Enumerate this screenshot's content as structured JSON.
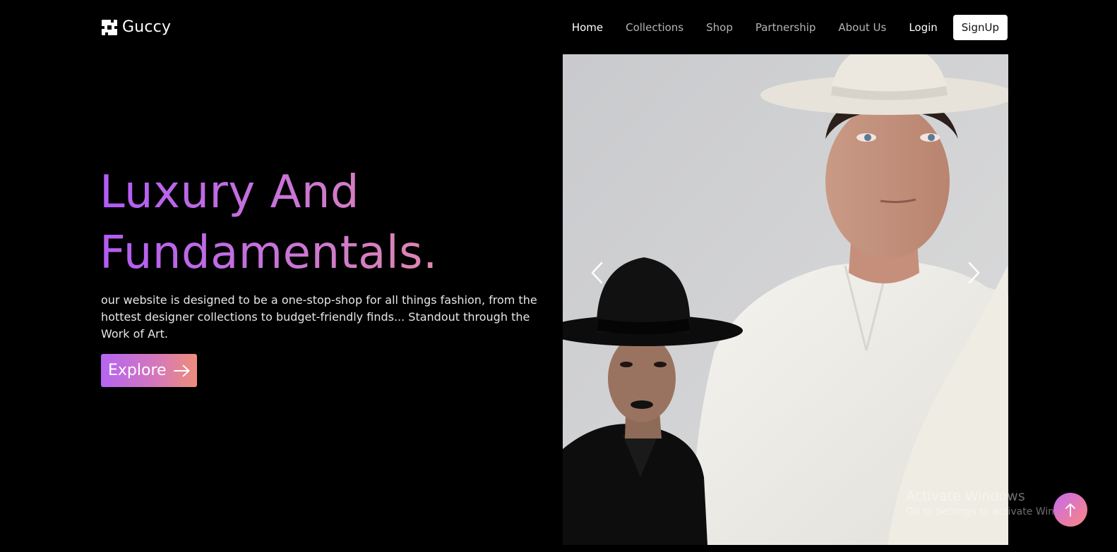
{
  "brand": {
    "name": "Guccy",
    "logo_icon": "cube-logo-icon"
  },
  "nav": {
    "links": [
      {
        "label": "Home",
        "active": true
      },
      {
        "label": "Collections",
        "active": false
      },
      {
        "label": "Shop",
        "active": false
      },
      {
        "label": "Partnership",
        "active": false
      },
      {
        "label": "About Us",
        "active": false
      }
    ],
    "login_label": "Login",
    "signup_label": "SignUp"
  },
  "hero": {
    "title_line1": "Luxury And",
    "title_line2": "Fundamentals.",
    "description": "our website is designed to be a one-stop-shop for all things fashion, from the hottest designer collections to budget-friendly finds... Standout through the Work of Art.",
    "cta_label": "Explore",
    "cta_icon": "arrow-right-icon",
    "gradient_colors": [
      "#b15cf5",
      "#c873d9",
      "#e88f9f"
    ]
  },
  "carousel": {
    "prev_icon": "chevron-left-icon",
    "next_icon": "chevron-right-icon",
    "image_subject": "fashion-models-photo"
  },
  "watermark": {
    "title": "Activate Windows",
    "subtitle": "Go to Settings to activate Windows."
  },
  "scroll_top": {
    "icon": "arrow-up-icon"
  },
  "colors": {
    "background": "#000000",
    "nav_text": "#b4b4b4",
    "nav_active": "#ffffff",
    "signup_bg": "#ffffff"
  }
}
